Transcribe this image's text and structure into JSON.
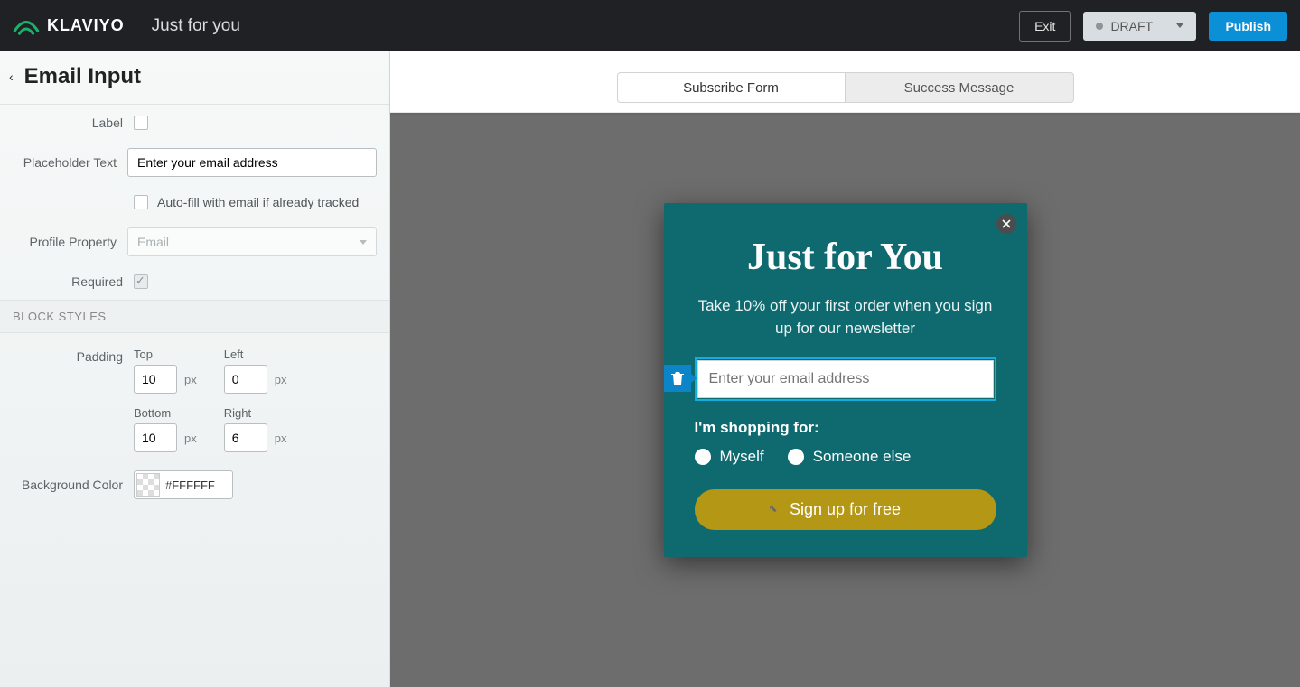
{
  "topbar": {
    "brand": "KLAVIYO",
    "form_name": "Just for you",
    "exit_label": "Exit",
    "status_label": "DRAFT",
    "publish_label": "Publish"
  },
  "sidebar": {
    "title": "Email Input",
    "fields": {
      "label_lbl": "Label",
      "placeholder_lbl": "Placeholder Text",
      "placeholder_val": "Enter your email address",
      "autofill_lbl": "Auto-fill with email if already tracked",
      "profile_lbl": "Profile Property",
      "profile_val": "Email",
      "required_lbl": "Required"
    },
    "block_styles_header": "BLOCK STYLES",
    "padding_lbl": "Padding",
    "padding": {
      "top_lbl": "Top",
      "top_val": "10",
      "left_lbl": "Left",
      "left_val": "0",
      "bottom_lbl": "Bottom",
      "bottom_val": "10",
      "right_lbl": "Right",
      "right_val": "6",
      "unit": "px"
    },
    "bgcolor_lbl": "Background Color",
    "bgcolor_val": "#FFFFFF"
  },
  "tabs": {
    "subscribe": "Subscribe Form",
    "success": "Success Message"
  },
  "popup": {
    "title": "Just for You",
    "subtitle": "Take 10% off your first order when you sign up for our newsletter",
    "email_placeholder": "Enter your email address",
    "shopping_label": "I'm shopping for:",
    "radio_myself": "Myself",
    "radio_someone": "Someone else",
    "cta_label": "Sign up for free"
  }
}
